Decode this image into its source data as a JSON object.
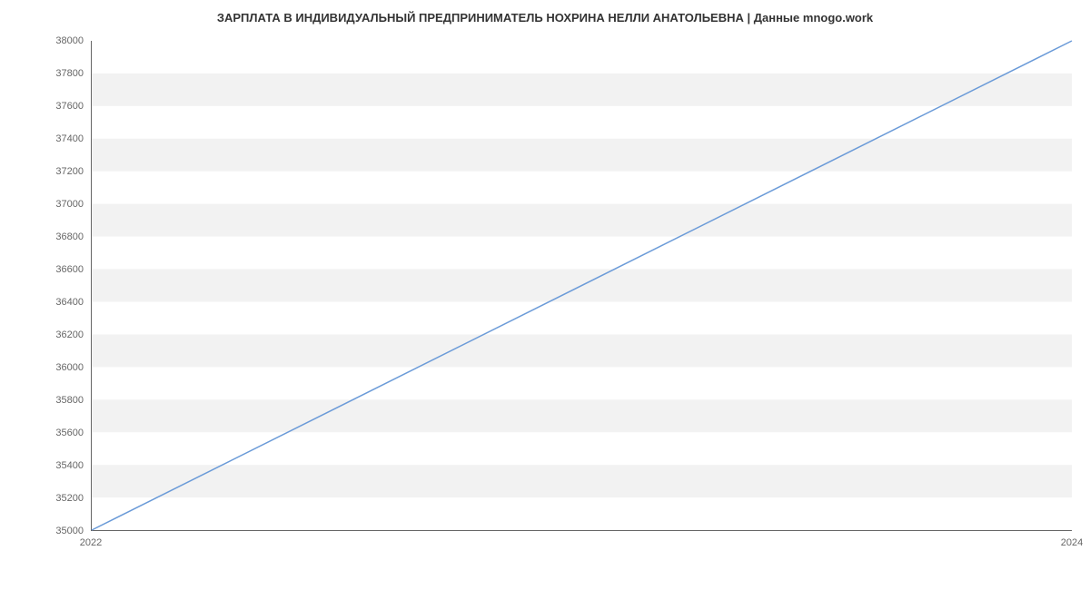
{
  "chart_data": {
    "type": "line",
    "title": "ЗАРПЛАТА В ИНДИВИДУАЛЬНЫЙ ПРЕДПРИНИМАТЕЛЬ НОХРИНА НЕЛЛИ АНАТОЛЬЕВНА | Данные mnogo.work",
    "x": [
      2022,
      2024
    ],
    "values": [
      35000,
      38000
    ],
    "xlabel": "",
    "ylabel": "",
    "x_ticks": [
      2022,
      2024
    ],
    "y_ticks": [
      35000,
      35200,
      35400,
      35600,
      35800,
      36000,
      36200,
      36400,
      36600,
      36800,
      37000,
      37200,
      37400,
      37600,
      37800,
      38000
    ],
    "xlim": [
      2022,
      2024
    ],
    "ylim": [
      35000,
      38000
    ],
    "line_color": "#6b9bd8"
  }
}
